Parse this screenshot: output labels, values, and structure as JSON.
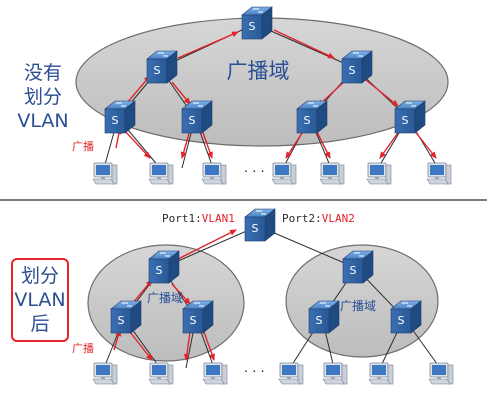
{
  "top_section": {
    "side_label": [
      "没有",
      "划分",
      "VLAN"
    ],
    "domain_label": "广播域",
    "broadcast_label": "广播",
    "switch_label": "S",
    "ellipsis": "· · ·"
  },
  "bottom_section": {
    "side_label": [
      "划分",
      "VLAN",
      "后"
    ],
    "domain_label_left": "广播域",
    "domain_label_right": "广播域",
    "broadcast_label": "广播",
    "switch_label": "S",
    "ellipsis": "· · ·",
    "port1": {
      "prefix": "Port1:",
      "vlan": "VLAN1"
    },
    "port2": {
      "prefix": "Port2:",
      "vlan": "VLAN2"
    }
  },
  "colors": {
    "domain_fill": "#c9c9c9",
    "switch_blue": "#2e5f9c",
    "broadcast_arrow": "#e3242b",
    "highlight_border": "#e3242b",
    "side_text": "#2a4e92"
  },
  "icons": [
    "switch-icon",
    "pc-icon",
    "broadcast-arrow-icon"
  ]
}
